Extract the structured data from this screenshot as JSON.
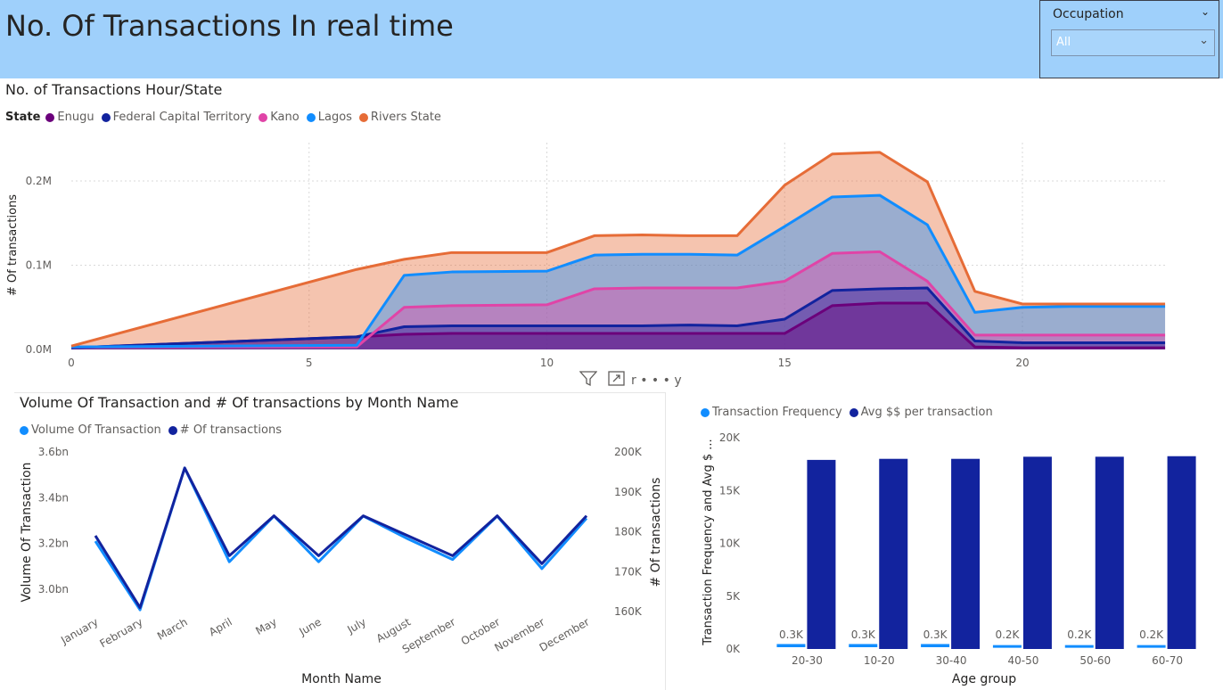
{
  "header": {
    "title": "No. Of Transactions In real time"
  },
  "slicer": {
    "label": "Occupation",
    "value": "All"
  },
  "toolbar": {
    "more_label": "r • • • y"
  },
  "charts": [
    {
      "id": "hour_state",
      "title": "No. of Transactions Hour/State",
      "legend_title": "State",
      "type": "area",
      "stacked": true,
      "x": [
        0,
        6,
        7,
        8,
        10,
        11,
        12,
        13,
        14,
        15,
        16,
        17,
        18,
        19,
        20,
        21,
        22,
        23
      ],
      "x_ticks": [
        "0",
        "5",
        "10",
        "15",
        "20"
      ],
      "y_ticks": [
        "0.0M",
        "0.1M",
        "0.2M"
      ],
      "ylabel": "# Of transactions",
      "ylim": [
        0,
        0.24
      ],
      "grid": true,
      "legend_position": "top-left",
      "series": [
        {
          "name": "Enugu",
          "color": "#6b007b",
          "values": [
            0.002,
            0.015,
            0.018,
            0.019,
            0.019,
            0.019,
            0.019,
            0.019,
            0.019,
            0.019,
            0.052,
            0.055,
            0.055,
            0.003,
            0.002,
            0.002,
            0.002,
            0.002
          ]
        },
        {
          "name": "Federal Capital Territory",
          "color": "#12239e",
          "values": [
            0.0,
            0.0,
            0.009,
            0.009,
            0.009,
            0.009,
            0.009,
            0.01,
            0.009,
            0.017,
            0.018,
            0.017,
            0.018,
            0.007,
            0.006,
            0.006,
            0.006,
            0.006
          ]
        },
        {
          "name": "Kano",
          "color": "#e044a7",
          "values": [
            0.001,
            -0.012,
            0.023,
            0.024,
            0.025,
            0.044,
            0.045,
            0.044,
            0.045,
            0.045,
            0.044,
            0.044,
            0.008,
            0.007,
            0.009,
            0.009,
            0.009,
            0.009
          ]
        },
        {
          "name": "Lagos",
          "color": "#118dff",
          "values": [
            0.0,
            0.002,
            0.038,
            0.04,
            0.04,
            0.04,
            0.04,
            0.04,
            0.039,
            0.065,
            0.067,
            0.067,
            0.067,
            0.027,
            0.033,
            0.034,
            0.034,
            0.034
          ]
        },
        {
          "name": "Rivers State",
          "color": "#e66c37",
          "values": [
            0.001,
            0.09,
            0.019,
            0.023,
            0.022,
            0.023,
            0.023,
            0.022,
            0.023,
            0.049,
            0.051,
            0.051,
            0.051,
            0.025,
            0.004,
            0.003,
            0.003,
            0.003
          ]
        }
      ]
    },
    {
      "id": "month_volume",
      "title": "Volume Of Transaction and # Of transactions by Month Name",
      "type": "line",
      "xlabel": "Month Name",
      "ylabel": "Volume Of Transaction",
      "y2label": "# Of transactions",
      "categories": [
        "January",
        "February",
        "March",
        "April",
        "May",
        "June",
        "July",
        "August",
        "September",
        "October",
        "November",
        "December"
      ],
      "y_ticks": [
        "3.0bn",
        "3.2bn",
        "3.4bn",
        "3.6bn"
      ],
      "y2_ticks": [
        "160K",
        "170K",
        "180K",
        "190K",
        "200K"
      ],
      "ylim": [
        2.9,
        3.6
      ],
      "y2lim": [
        157,
        200
      ],
      "legend_position": "top-left",
      "series": [
        {
          "name": "Volume Of Transaction",
          "color": "#118dff",
          "axis": "left",
          "values": [
            3.21,
            2.91,
            3.53,
            3.12,
            3.32,
            3.12,
            3.32,
            3.22,
            3.13,
            3.32,
            3.09,
            3.31
          ]
        },
        {
          "name": "# Of transactions",
          "color": "#12239e",
          "axis": "right",
          "values": [
            179,
            161,
            196,
            174,
            184,
            174,
            184,
            179,
            174,
            184,
            172,
            184
          ]
        }
      ]
    },
    {
      "id": "age_group",
      "title": "",
      "type": "bar",
      "xlabel": "Age group",
      "ylabel": "Transaction Frequency and Avg $ ...",
      "categories": [
        "20-30",
        "10-20",
        "30-40",
        "40-50",
        "50-60",
        "60-70"
      ],
      "y_ticks": [
        "0K",
        "5K",
        "10K",
        "15K",
        "20K"
      ],
      "ylim": [
        0,
        20000
      ],
      "legend_position": "top-left",
      "series": [
        {
          "name": "Transaction Frequency",
          "color": "#118dff",
          "values": [
            300,
            300,
            300,
            200,
            200,
            200
          ],
          "labels": [
            "0.3K",
            "0.3K",
            "0.3K",
            "0.2K",
            "0.2K",
            "0.2K"
          ]
        },
        {
          "name": "Avg $$ per transaction",
          "color": "#12239e",
          "values": [
            17900,
            18000,
            18000,
            18200,
            18200,
            18250
          ]
        }
      ]
    }
  ]
}
